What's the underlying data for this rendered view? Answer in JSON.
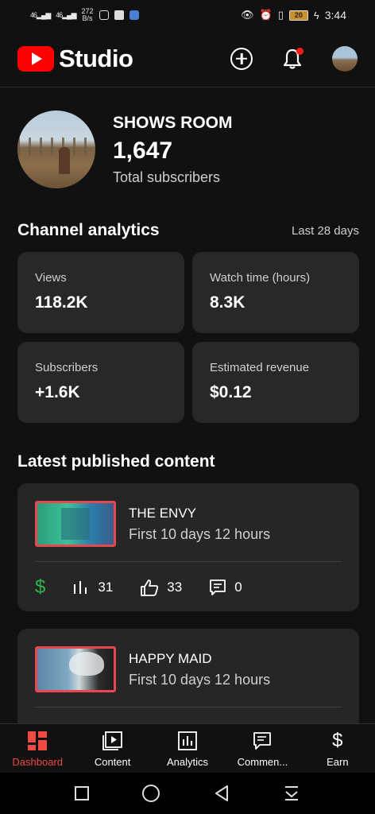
{
  "status_bar": {
    "signal1": "46",
    "signal2": "46",
    "net_speed_value": "272",
    "net_speed_unit": "B/s",
    "battery": "20",
    "time": "3:44"
  },
  "header": {
    "brand": "Studio"
  },
  "channel": {
    "name": "SHOWS ROOM",
    "subscriber_count": "1,647",
    "subscriber_label": "Total subscribers"
  },
  "analytics": {
    "title": "Channel analytics",
    "period": "Last 28 days",
    "cards": [
      {
        "label": "Views",
        "value": "118.2K"
      },
      {
        "label": "Watch time (hours)",
        "value": "8.3K"
      },
      {
        "label": "Subscribers",
        "value": "+1.6K"
      },
      {
        "label": "Estimated revenue",
        "value": "$0.12"
      }
    ]
  },
  "latest": {
    "title": "Latest published content",
    "items": [
      {
        "title": "THE ENVY",
        "subtitle": "First 10 days 12 hours",
        "views": "31",
        "likes": "33",
        "comments": "0"
      },
      {
        "title": "HAPPY MAID",
        "subtitle": "First 10 days 12 hours"
      }
    ]
  },
  "nav": {
    "items": [
      {
        "label": "Dashboard",
        "icon": "dashboard-icon"
      },
      {
        "label": "Content",
        "icon": "content-icon"
      },
      {
        "label": "Analytics",
        "icon": "analytics-icon"
      },
      {
        "label": "Commen...",
        "icon": "comments-icon"
      },
      {
        "label": "Earn",
        "icon": "dollar-icon"
      }
    ]
  },
  "colors": {
    "accent": "#ff0000",
    "nav_active": "#ef4a44",
    "revenue_green": "#2fb34a",
    "card_bg": "#282828"
  }
}
